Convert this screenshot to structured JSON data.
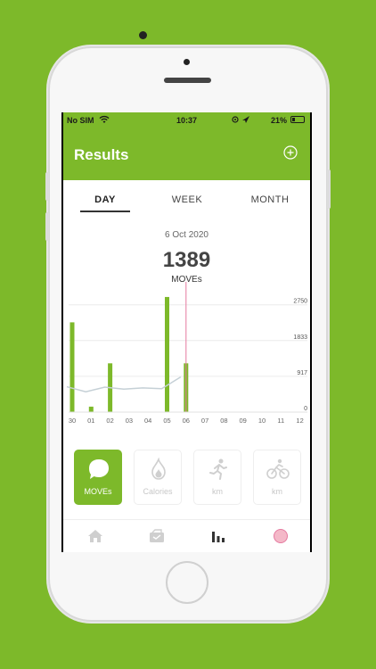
{
  "status_bar": {
    "carrier": "No SIM",
    "time": "10:37",
    "battery": "21%"
  },
  "header": {
    "title": "Results"
  },
  "tabs": [
    {
      "label": "DAY"
    },
    {
      "label": "WEEK"
    },
    {
      "label": "MONTH"
    }
  ],
  "summary": {
    "date": "6 Oct 2020",
    "value": "1389",
    "unit": "MOVEs"
  },
  "chart_data": {
    "type": "bar",
    "categories": [
      "30",
      "01",
      "02",
      "03",
      "04",
      "05",
      "06",
      "07",
      "08",
      "09",
      "10",
      "11",
      "12"
    ],
    "values": [
      2300,
      140,
      1250,
      0,
      0,
      2950,
      1250,
      0,
      0,
      0,
      0,
      0,
      0
    ],
    "trend": [
      650,
      520,
      640,
      590,
      620,
      600,
      900
    ],
    "yticks": [
      0,
      917,
      1833,
      2750
    ],
    "ylim": [
      0,
      3200
    ],
    "selected_index": 6,
    "colors": {
      "bar": "#7db92a",
      "trend": "#c5d0d6",
      "marker": "#e57aa0"
    }
  },
  "activity_cards": [
    {
      "label": "MOVEs",
      "icon": "moves-icon",
      "active": true
    },
    {
      "label": "Calories",
      "icon": "flame-icon",
      "active": false
    },
    {
      "label": "km",
      "icon": "running-icon",
      "active": false
    },
    {
      "label": "km",
      "icon": "cycling-icon",
      "active": false
    }
  ],
  "tab_bar": [
    {
      "icon": "home-icon"
    },
    {
      "icon": "wallet-icon"
    },
    {
      "icon": "stats-icon"
    },
    {
      "icon": "profile-icon"
    }
  ],
  "colors": {
    "brand": "#7db92a"
  }
}
